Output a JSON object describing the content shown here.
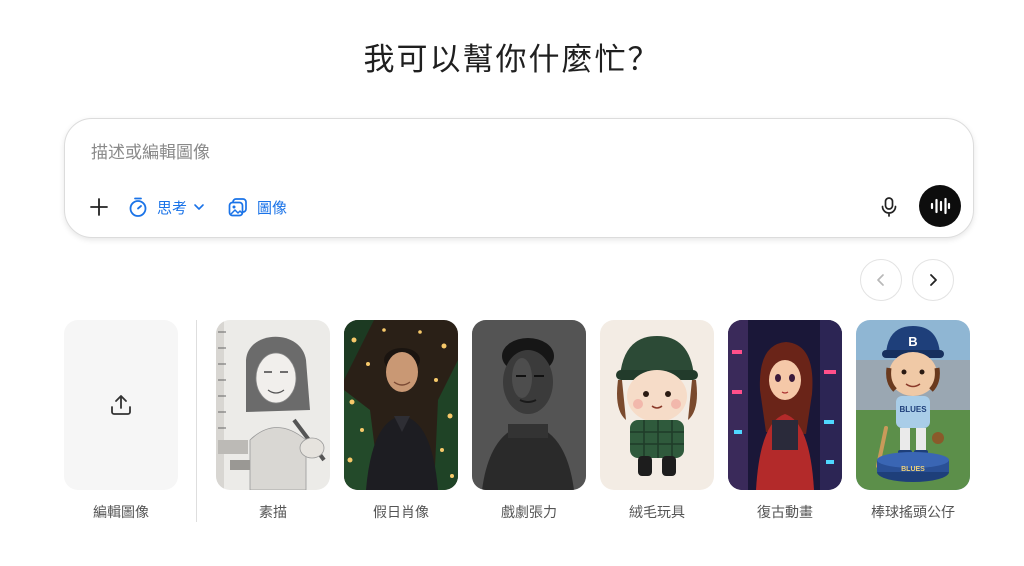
{
  "heading": "我可以幫你什麼忙？",
  "composer": {
    "placeholder": "描述或編輯圖像",
    "think_label": "思考",
    "image_label": "圖像"
  },
  "upload": {
    "label": "編輯圖像"
  },
  "styles": [
    {
      "label": "素描"
    },
    {
      "label": "假日肖像"
    },
    {
      "label": "戲劇張力"
    },
    {
      "label": "絨毛玩具"
    },
    {
      "label": "復古動畫"
    },
    {
      "label": "棒球搖頭公仔"
    }
  ],
  "bobblehead_cap_letter": "B",
  "bobblehead_jersey_text": "BLUES",
  "bobblehead_base_text": "BLUES",
  "colors": {
    "accent": "#1a73e8",
    "voice_button": "#0d0d0d",
    "text": "#1f1f1f"
  }
}
